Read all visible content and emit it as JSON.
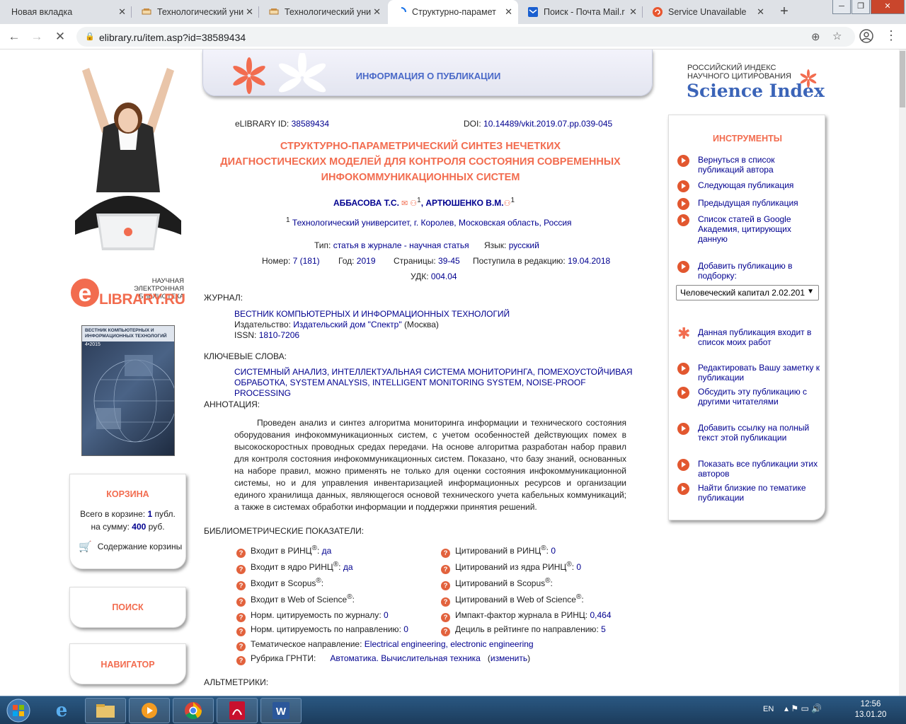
{
  "browser": {
    "tabs": [
      {
        "title": "Новая вкладка",
        "icon": "new-tab-icon"
      },
      {
        "title": "Технологический уни",
        "icon": "hat-icon"
      },
      {
        "title": "Технологический уни",
        "icon": "hat-icon"
      },
      {
        "title": "Структурно-парамет",
        "icon": "loading-icon",
        "active": true
      },
      {
        "title": "Поиск - Почта Mail.r",
        "icon": "mail-icon"
      },
      {
        "title": "Service Unavailable",
        "icon": "error-icon"
      }
    ],
    "url": "elibrary.ru/item.asp?id=38589434"
  },
  "header": {
    "title": "ИНФОРМАЦИЯ О ПУБЛИКАЦИИ"
  },
  "science_index": {
    "line1": "РОССИЙСКИЙ ИНДЕКС",
    "line2": "НАУЧНОГО ЦИТИРОВАНИЯ",
    "name": "Science Index"
  },
  "sidebar": {
    "logo_line1": "НАУЧНАЯ ЭЛЕКТРОННАЯ",
    "logo_line2": "БИБЛИОТЕКА",
    "logo_name": "LIBRARY.RU",
    "logo_e": "e",
    "cover_title": "ВЕСТНИК КОМПЬЮТЕРНЫХ И ИНФОРМАЦИОННЫХ ТЕХНОЛОГИЙ",
    "cover_year": "4•2015",
    "cart": {
      "title": "КОРЗИНА",
      "total_label": "Всего в корзине:",
      "total_value": "1",
      "total_unit": "публ.",
      "sum_label": "на сумму:",
      "sum_value": "400",
      "sum_unit": "руб.",
      "contents": "Содержание корзины"
    },
    "search": "ПОИСК",
    "navigator": "НАВИГАТОР"
  },
  "article": {
    "elibrary_id_label": "eLIBRARY ID:",
    "elibrary_id": "38589434",
    "doi_label": "DOI:",
    "doi": "10.14489/vkit.2019.07.pp.039-045",
    "title_l1": "СТРУКТУРНО-ПАРАМЕТРИЧЕСКИЙ СИНТЕЗ НЕЧЕТКИХ",
    "title_l2": "ДИАГНОСТИЧЕСКИХ МОДЕЛЕЙ ДЛЯ КОНТРОЛЯ СОСТОЯНИЯ СОВРЕМЕННЫХ",
    "title_l3": "ИНФОКОММУНИКАЦИОННЫХ СИСТЕМ",
    "author1": "АББАСОВА Т.С.",
    "author2": "АРТЮШЕНКО В.М.",
    "aff_sup": "1",
    "affiliation": "Технологический университет, г. Королев, Московская область, Россия",
    "type_label": "Тип:",
    "type": "статья в журнале - научная статья",
    "lang_label": "Язык:",
    "lang": "русский",
    "number_label": "Номер:",
    "number": "7 (181)",
    "year_label": "Год:",
    "year": "2019",
    "pages_label": "Страницы:",
    "pages": "39-45",
    "received_label": "Поступила в редакцию:",
    "received": "19.04.2018",
    "udk_label": "УДК:",
    "udk": "004.04",
    "journal_h": "ЖУРНАЛ:",
    "journal": "ВЕСТНИК КОМПЬЮТЕРНЫХ И ИНФОРМАЦИОННЫХ ТЕХНОЛОГИЙ",
    "publisher_label": "Издательство:",
    "publisher": "Издательский дом \"Спектр\"",
    "publisher_city": "(Москва)",
    "issn_label": "ISSN:",
    "issn": "1810-7206",
    "keywords_h": "КЛЮЧЕВЫЕ СЛОВА:",
    "keywords_l1": "СИСТЕМНЫЙ АНАЛИЗ, ИНТЕЛЛЕКТУАЛЬНАЯ СИСТЕМА МОНИТОРИНГА, ПОМЕХОУСТОЙЧИВАЯ",
    "keywords_l2": "ОБРАБОТКА, SYSTEM ANALYSIS, INTELLIGENT MONITORING SYSTEM, NOISE-PROOF PROCESSING",
    "abstract_h": "АННОТАЦИЯ:",
    "abstract": "Проведен анализ и синтез алгоритма мониторинга информации и технического состояния оборудования инфокоммуникационных систем, с учетом особенностей действующих помех в высокоскоростных проводных средах передачи. На основе алгоритма разработан набор правил для контроля состояния инфокоммуникационных систем. Показано, что базу знаний, основанных на наборе правил, можно применять не только для оценки состояния инфокоммуникационной системы, но и для управления инвентаризацией информационных ресурсов и организации единого хранилища данных, являющегося основой технического учета кабельных коммуникаций; а также в системах обработки информации и поддержки принятия решений.",
    "biblio_h": "БИБЛИОМЕТРИЧЕСКИЕ ПОКАЗАТЕЛИ:",
    "biblio_left": [
      {
        "label": "Входит в РИНЦ",
        "sup": "®",
        "sep": ":",
        "value": "да"
      },
      {
        "label": "Входит в ядро РИНЦ",
        "sup": "®",
        "sep": ":",
        "value": "да"
      },
      {
        "label": "Входит в Scopus",
        "sup": "®",
        "sep": ":",
        "value": ""
      },
      {
        "label": "Входит в Web of Science",
        "sup": "®",
        "sep": ":",
        "value": ""
      },
      {
        "label": "Норм. цитируемость по журналу",
        "sup": "",
        "sep": ":",
        "value": "0"
      },
      {
        "label": "Норм. цитируемость по направлению",
        "sup": "",
        "sep": ":",
        "value": "0"
      }
    ],
    "biblio_right": [
      {
        "label": "Цитирований в РИНЦ",
        "sup": "®",
        "sep": ":",
        "value": "0"
      },
      {
        "label": "Цитирований из ядра РИНЦ",
        "sup": "®",
        "sep": ":",
        "value": "0"
      },
      {
        "label": "Цитирований в Scopus",
        "sup": "®",
        "sep": ":",
        "value": ""
      },
      {
        "label": "Цитирований в Web of Science",
        "sup": "®",
        "sep": ":",
        "value": ""
      },
      {
        "label": "Импакт-фактор журнала в РИНЦ",
        "sup": "",
        "sep": ":",
        "value": "0,464"
      },
      {
        "label": "Дециль в рейтинге по направлению",
        "sup": "",
        "sep": ":",
        "value": "5"
      }
    ],
    "topic_label": "Тематическое направление:",
    "topic": "Electrical engineering, electronic engineering",
    "grnti_label": "Рубрика ГРНТИ:",
    "grnti": "Автоматика. Вычислительная техника",
    "grnti_change": "изменить",
    "altmetrics_h": "АЛЬТМЕТРИКИ:"
  },
  "tools": {
    "title": "ИНСТРУМЕНТЫ",
    "items": [
      {
        "l1": "Вернуться в список",
        "l2": "публикаций автора",
        "l3": ""
      },
      {
        "l1": "Следующая публикация",
        "l2": "",
        "l3": ""
      },
      {
        "l1": "Предыдущая публикация",
        "l2": "",
        "l3": ""
      },
      {
        "l1": "Список статей в Google",
        "l2": "Академия, цитирующих",
        "l3": "данную"
      },
      {
        "l1": "Добавить публикацию в",
        "l2": "подборку:",
        "l3": ""
      },
      {
        "l1": "Данная публикация входит в",
        "l2": "список моих работ",
        "l3": ""
      },
      {
        "l1": "Редактировать Вашу заметку к",
        "l2": "публикации",
        "l3": ""
      },
      {
        "l1": "Обсудить эту публикацию с",
        "l2": "другими читателями",
        "l3": ""
      },
      {
        "l1": "Добавить ссылку на полный",
        "l2": "текст этой публикации",
        "l3": ""
      },
      {
        "l1": "Показать все публикации этих",
        "l2": "авторов",
        "l3": ""
      },
      {
        "l1": "Найти близкие по тематике",
        "l2": "публикации",
        "l3": ""
      }
    ],
    "selection": "Человеческий капитал 2.02.201"
  },
  "taskbar": {
    "lang": "EN",
    "time": "12:56",
    "date": "13.01.20"
  },
  "colors": {
    "accent": "#f26c4f",
    "link": "#00008f",
    "header_title": "#4a69c8",
    "science_index": "#3b64b8"
  }
}
